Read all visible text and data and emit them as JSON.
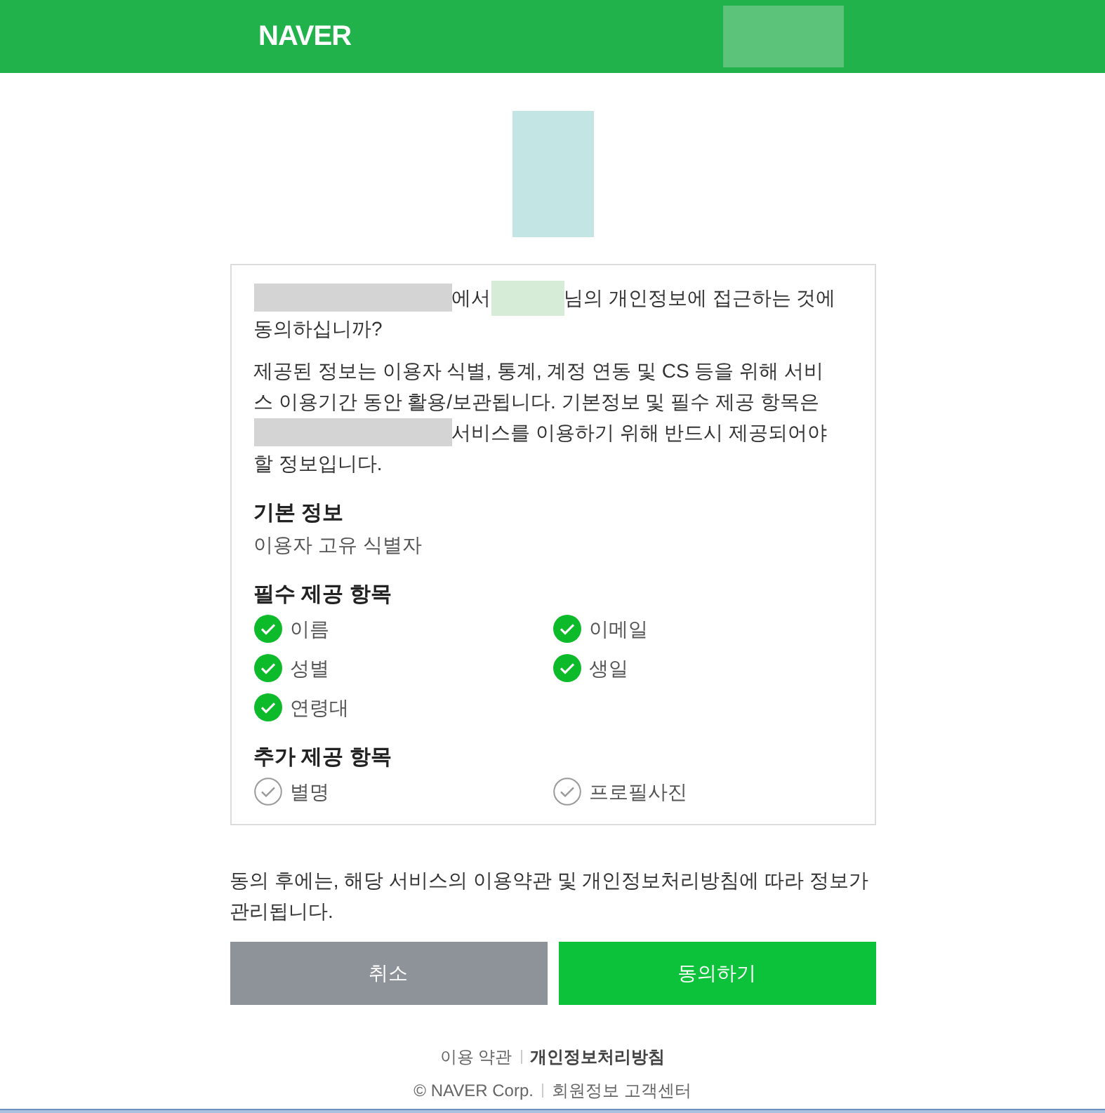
{
  "header": {
    "logo": "NAVER",
    "account": {
      "kind": "redacted"
    }
  },
  "app_logo": {
    "kind": "redacted"
  },
  "question": [
    [
      {
        "kind": "redacted"
      },
      {
        "kind": "text",
        "text": "에서"
      },
      {
        "kind": "redacted_name"
      },
      {
        "kind": "text",
        "text": "님의 개인정보에 접근하는 것에"
      }
    ],
    [
      {
        "kind": "text",
        "text": "동의하십니까?"
      }
    ]
  ],
  "notice": [
    [
      {
        "kind": "text",
        "text": "제공된 정보는 이용자 식별, 통계, 계정 연동 및 CS 등을 위해 서비"
      }
    ],
    [
      {
        "kind": "text",
        "text": "스 이용기간 동안 활용/보관됩니다. 기본정보 및 필수 제공 항목은"
      }
    ],
    [
      {
        "kind": "redacted"
      },
      {
        "kind": "text",
        "text": "서비스를 이용하기 위해 반드시 제공되어야"
      }
    ],
    [
      {
        "kind": "text",
        "text": "할 정보입니다."
      }
    ]
  ],
  "sections": [
    {
      "title": "기본 정보",
      "kind": "plain",
      "text": "이용자 고유 식별자"
    },
    {
      "title": "필수 제공 항목",
      "kind": "checklist",
      "items": [
        {
          "label": "이름",
          "checked": true
        },
        {
          "label": "이메일",
          "checked": true
        },
        {
          "label": "성별",
          "checked": true
        },
        {
          "label": "생일",
          "checked": true
        },
        {
          "label": "연령대",
          "checked": true
        }
      ]
    },
    {
      "title": "추가 제공 항목",
      "kind": "checklist",
      "items": [
        {
          "label": "별명",
          "checked": false
        },
        {
          "label": "프로필사진",
          "checked": false
        }
      ]
    }
  ],
  "after_notice": "동의 후에는, 해당 서비스의 이용약관 및 개인정보처리방침에 따라 정보가 관리됩니다.",
  "buttons": [
    {
      "label": "취소",
      "kind": "cancel"
    },
    {
      "label": "동의하기",
      "kind": "confirm"
    }
  ],
  "footer": {
    "links": [
      {
        "label": "이용 약관",
        "bold": false
      },
      {
        "label": "개인정보처리방침",
        "bold": true
      }
    ],
    "copyright": "© NAVER Corp.",
    "support": "회원정보 고객센터"
  }
}
